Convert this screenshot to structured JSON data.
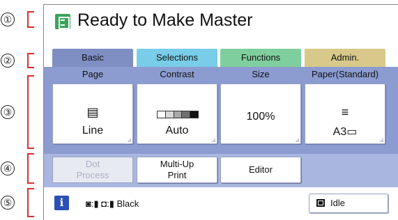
{
  "title": "Ready to Make Master",
  "callouts": [
    "①",
    "②",
    "③",
    "④",
    "⑤"
  ],
  "tabs": [
    "Basic",
    "Selections",
    "Functions",
    "Admin."
  ],
  "columns": [
    {
      "head": "Page",
      "icon": "▤",
      "label": "Line"
    },
    {
      "head": "Contrast",
      "label": "Auto"
    },
    {
      "head": "Size",
      "label": "100%"
    },
    {
      "head": "Paper(Standard)",
      "icon": "≡",
      "label": "A3▭"
    }
  ],
  "functions": [
    "Dot\nProcess",
    "Multi-Up\nPrint",
    "Editor"
  ],
  "status": {
    "text": "◙:▮  ◘:▮  Black",
    "idle": "Idle"
  },
  "colors": {
    "tab_basic": "#7f8fc4",
    "tab_selections": "#79cde9",
    "tab_functions": "#7fcf9e",
    "tab_admin": "#d8c98a",
    "bracket": "#d9302c",
    "info": "#2c50b5"
  }
}
